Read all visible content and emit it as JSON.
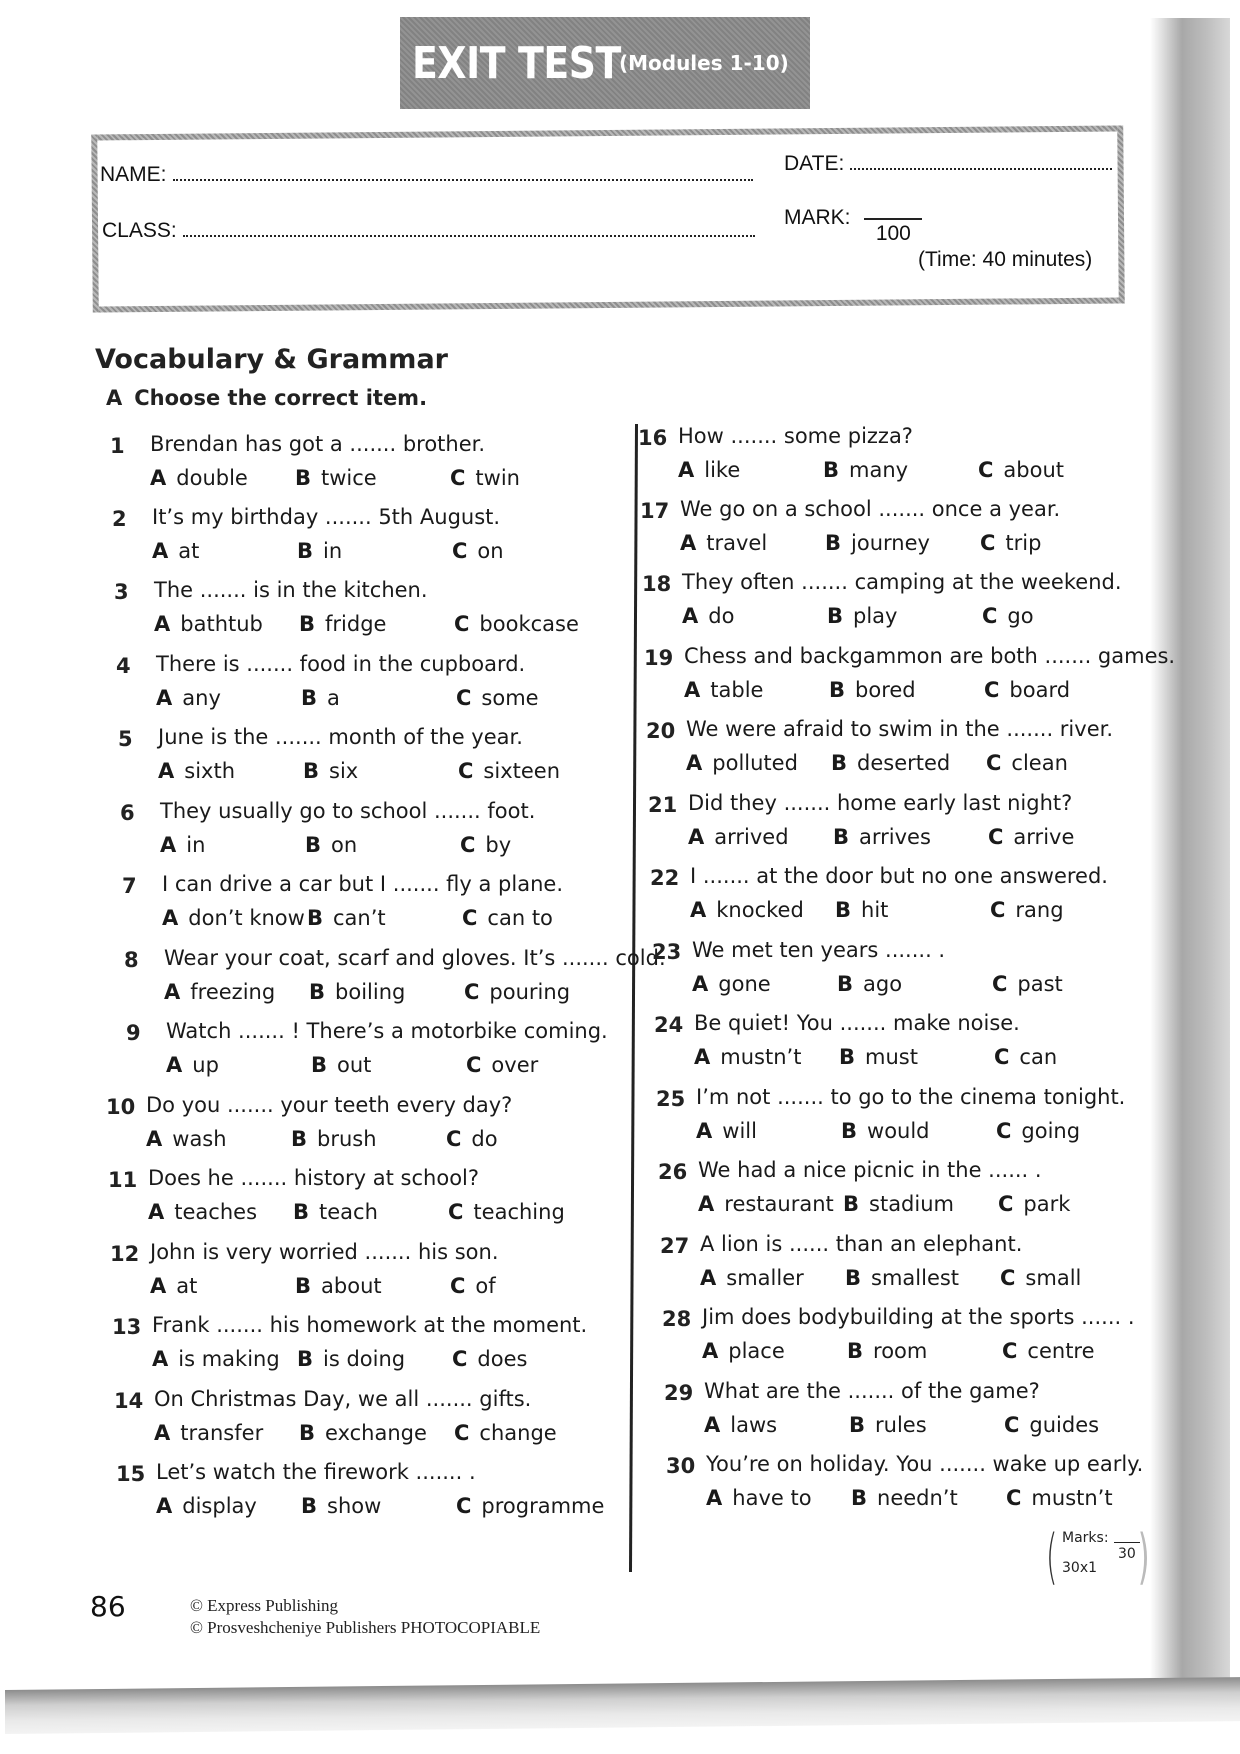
{
  "header": {
    "title": "EXIT TEST",
    "subtitle": "(Modules 1-10)"
  },
  "info": {
    "name_label": "NAME:",
    "class_label": "CLASS:",
    "date_label": "DATE:",
    "mark_label": "MARK:",
    "mark_total": "100",
    "time": "(Time: 40 minutes)"
  },
  "section": {
    "title": "Vocabulary & Grammar",
    "instruction_letter": "A",
    "instruction": "Choose the correct item."
  },
  "questions": [
    {
      "num": "1",
      "stem": "Brendan has got a ....... brother.",
      "a": "double",
      "b": "twice",
      "c": "twin"
    },
    {
      "num": "2",
      "stem": "It’s my birthday ....... 5th August.",
      "a": "at",
      "b": "in",
      "c": "on"
    },
    {
      "num": "3",
      "stem": "The ....... is in the kitchen.",
      "a": "bathtub",
      "b": "fridge",
      "c": "bookcase"
    },
    {
      "num": "4",
      "stem": "There is ....... food in the cupboard.",
      "a": "any",
      "b": "a",
      "c": "some"
    },
    {
      "num": "5",
      "stem": "June is the ....... month of the year.",
      "a": "sixth",
      "b": "six",
      "c": "sixteen"
    },
    {
      "num": "6",
      "stem": "They usually go to school ....... foot.",
      "a": "in",
      "b": "on",
      "c": "by"
    },
    {
      "num": "7",
      "stem": "I can drive a car but I ....... fly a plane.",
      "a": "don’t know",
      "b": "can’t",
      "c": "can to"
    },
    {
      "num": "8",
      "stem": "Wear your coat, scarf and gloves. It’s ....... cold.",
      "a": "freezing",
      "b": "boiling",
      "c": "pouring"
    },
    {
      "num": "9",
      "stem": "Watch ....... ! There’s a motorbike coming.",
      "a": "up",
      "b": "out",
      "c": "over"
    },
    {
      "num": "10",
      "stem": "Do you ....... your teeth every day?",
      "a": "wash",
      "b": "brush",
      "c": "do"
    },
    {
      "num": "11",
      "stem": "Does he ....... history at school?",
      "a": "teaches",
      "b": "teach",
      "c": "teaching"
    },
    {
      "num": "12",
      "stem": "John is very worried ....... his son.",
      "a": "at",
      "b": "about",
      "c": "of"
    },
    {
      "num": "13",
      "stem": "Frank ....... his homework at the moment.",
      "a": "is making",
      "b": "is doing",
      "c": "does"
    },
    {
      "num": "14",
      "stem": "On Christmas Day, we all ....... gifts.",
      "a": "transfer",
      "b": "exchange",
      "c": "change"
    },
    {
      "num": "15",
      "stem": "Let’s watch the firework ....... .",
      "a": "display",
      "b": "show",
      "c": "programme"
    },
    {
      "num": "16",
      "stem": "How ....... some pizza?",
      "a": "like",
      "b": "many",
      "c": "about"
    },
    {
      "num": "17",
      "stem": "We go on a school ....... once a year.",
      "a": "travel",
      "b": "journey",
      "c": "trip"
    },
    {
      "num": "18",
      "stem": "They often ....... camping at the weekend.",
      "a": "do",
      "b": "play",
      "c": "go"
    },
    {
      "num": "19",
      "stem": "Chess and backgammon are both  ....... games.",
      "a": "table",
      "b": "bored",
      "c": "board"
    },
    {
      "num": "20",
      "stem": "We were afraid to swim in the ....... river.",
      "a": "polluted",
      "b": "deserted",
      "c": "clean"
    },
    {
      "num": "21",
      "stem": "Did they ....... home early last night?",
      "a": "arrived",
      "b": "arrives",
      "c": "arrive"
    },
    {
      "num": "22",
      "stem": "I ....... at the door but no one answered.",
      "a": "knocked",
      "b": "hit",
      "c": "rang"
    },
    {
      "num": "23",
      "stem": "We met ten years ....... .",
      "a": "gone",
      "b": "ago",
      "c": "past"
    },
    {
      "num": "24",
      "stem": "Be quiet! You ....... make noise.",
      "a": "mustn’t",
      "b": "must",
      "c": "can"
    },
    {
      "num": "25",
      "stem": "I’m not ....... to go to the cinema tonight.",
      "a": "will",
      "b": "would",
      "c": "going"
    },
    {
      "num": "26",
      "stem": "We had a nice picnic in the ...... .",
      "a": "restaurant",
      "b": "stadium",
      "c": "park"
    },
    {
      "num": "27",
      "stem": "A lion is ...... than an elephant.",
      "a": "smaller",
      "b": "smallest",
      "c": "small"
    },
    {
      "num": "28",
      "stem": "Jim does bodybuilding at the sports ...... .",
      "a": "place",
      "b": "room",
      "c": "centre"
    },
    {
      "num": "29",
      "stem": "What are the ....... of the game?",
      "a": "laws",
      "b": "rules",
      "c": "guides"
    },
    {
      "num": "30",
      "stem": "You’re on holiday. You ....... wake up early.",
      "a": "have to",
      "b": "needn’t",
      "c": "mustn’t"
    }
  ],
  "option_letters": {
    "a": "A",
    "b": "B",
    "c": "C"
  },
  "marks": {
    "label": "Marks:",
    "multiplier": "30x1",
    "total": "30"
  },
  "footer": {
    "page_number": "86",
    "copyright_1": "© Express Publishing",
    "copyright_2": "© Prosveshcheniye Publishers PHOTOCOPIABLE"
  }
}
